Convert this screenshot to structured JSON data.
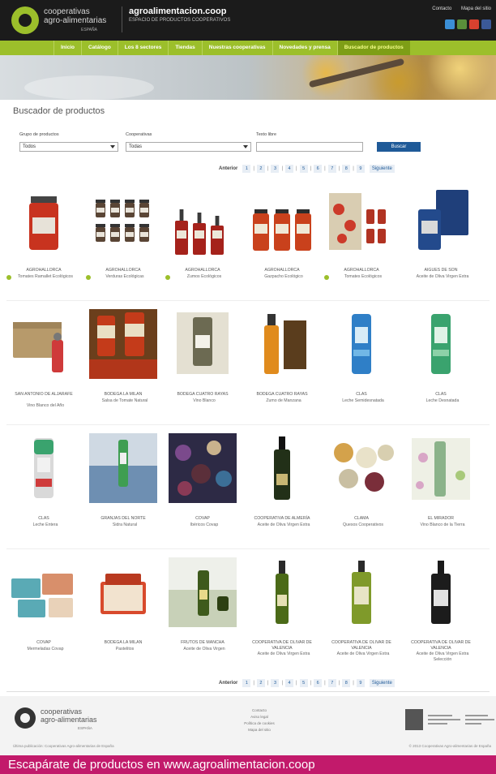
{
  "header": {
    "logo": {
      "line1": "cooperativas",
      "line2": "agro-alimentarias",
      "line3": "ESPAÑA"
    },
    "site_title": "agroalimentacion.coop",
    "site_subtitle": "ESPACIO DE PRODUCTOS COOPERATIVOS",
    "top_links": [
      "Contacto",
      "Mapa del sitio"
    ],
    "social_colors": [
      "#3b8fd6",
      "#5a8f3a",
      "#d9412f",
      "#3b5998"
    ]
  },
  "nav": {
    "items": [
      "Inicio",
      "Catálogo",
      "Los 8 sectores",
      "Tiendas",
      "Nuestras cooperativas",
      "Novedades y prensa",
      "Buscador de productos"
    ],
    "active_index": 6
  },
  "page_title": "Buscador de productos",
  "filters": {
    "group_label": "Grupo de productos",
    "group_value": "Todos",
    "coop_label": "Cooperativas",
    "coop_value": "Todas",
    "text_label": "Texto libre",
    "button_label": "Buscar"
  },
  "pager": {
    "label": "Anterior",
    "pages": [
      "1",
      "2",
      "3",
      "4",
      "5",
      "6",
      "7",
      "8",
      "9"
    ],
    "next_label": "Siguiente"
  },
  "products": [
    {
      "brand": "AGROHALLORCA",
      "name": "Tomates Ramallet Ecológicos",
      "eco": true,
      "kind": "jar-red"
    },
    {
      "brand": "AGROHALLORCA",
      "name": "Verduras Ecológicas",
      "eco": true,
      "kind": "jars-6"
    },
    {
      "brand": "AGROHALLORCA",
      "name": "Zumos Ecológicos",
      "eco": true,
      "kind": "bottles-red"
    },
    {
      "brand": "AGROHALLORCA",
      "name": "Gazpacho Ecológico",
      "eco": false,
      "kind": "jars-3"
    },
    {
      "brand": "AGROHALLORCA",
      "name": "Tomates Ecológicos",
      "eco": true,
      "kind": "tomato-pack"
    },
    {
      "brand": "AIGUES DE SON",
      "name": "Aceite de Oliva Virgen Extra",
      "eco": false,
      "kind": "blue-pack"
    },
    {
      "brand": "SAN ANTONIO DE ALJARAFE",
      "name": "Vino Blanco del Año",
      "eco": false,
      "kind": "box-bottle"
    },
    {
      "brand": "BODEGA LA MILAN",
      "name": "Salsa de Tomate Natural",
      "eco": false,
      "kind": "sauce-jars"
    },
    {
      "brand": "BODEGA CUATRO RAYAS",
      "name": "Vino Blanco",
      "eco": false,
      "kind": "wine-label"
    },
    {
      "brand": "BODEGA CUATRO RAYAS",
      "name": "Zumo de Manzana",
      "eco": false,
      "kind": "amber-bottle"
    },
    {
      "brand": "CLAS",
      "name": "Leche Semidesnatada",
      "eco": false,
      "kind": "milk-blue"
    },
    {
      "brand": "CLAS",
      "name": "Leche Desnatada",
      "eco": false,
      "kind": "milk-green"
    },
    {
      "brand": "CLAS",
      "name": "Leche Entera",
      "eco": false,
      "kind": "milk-red"
    },
    {
      "brand": "GRANJAS DEL NORTE",
      "name": "Sidra Natural",
      "eco": false,
      "kind": "green-bottle"
    },
    {
      "brand": "COVAP",
      "name": "Ibéricos Covap",
      "eco": false,
      "kind": "ham-photo"
    },
    {
      "brand": "COOPERATIVA DE ALMERÍA",
      "name": "Aceite de Oliva Virgen Extra",
      "eco": false,
      "kind": "dark-bottle"
    },
    {
      "brand": "CLAMA",
      "name": "Quesos Cooperativos",
      "eco": false,
      "kind": "cheese-plate"
    },
    {
      "brand": "EL MIRADOR",
      "name": "Vino Blanco de la Tierra",
      "eco": false,
      "kind": "floral-bottle"
    },
    {
      "brand": "COVAP",
      "name": "Mermeladas Covap",
      "eco": false,
      "kind": "boxes-teal"
    },
    {
      "brand": "BODEGA LA MILAN",
      "name": "Pastelitos",
      "eco": false,
      "kind": "open-box"
    },
    {
      "brand": "FRUTOS DE MANCHA",
      "name": "Aceite de Oliva Virgen",
      "eco": false,
      "kind": "oil-table"
    },
    {
      "brand": "COOPERATIVA DE OLIVAR DE VALENCIA",
      "name": "Aceite de Oliva Virgen Extra",
      "eco": false,
      "kind": "oil-bottle-1"
    },
    {
      "brand": "COOPERATIVA DE OLIVAR DE VALENCIA",
      "name": "Aceite de Oliva Virgen Extra",
      "eco": false,
      "kind": "oil-bottle-2"
    },
    {
      "brand": "COOPERATIVA DE OLIVAR DE VALENCIA",
      "name": "Aceite de Oliva Virgen Extra Selección",
      "eco": false,
      "kind": "oil-bottle-3"
    }
  ],
  "footer": {
    "logo": {
      "line1": "cooperativas",
      "line2": "agro-alimentarias",
      "line3": "ESPAÑA"
    },
    "links": [
      "Contacto",
      "Aviso legal",
      "Política de cookies",
      "Mapa del sitio"
    ],
    "left_text": "Última publicación: Cooperativas Agro-alimentarias de España",
    "right_text": "© 2013 Cooperativas Agro-alimentarias de España"
  },
  "caption": "Escapárate de productos en www.agroalimentacion.coop",
  "colors": {
    "green": "#9cbf2b",
    "blue": "#1f5a98",
    "magenta": "#c21a6b"
  }
}
